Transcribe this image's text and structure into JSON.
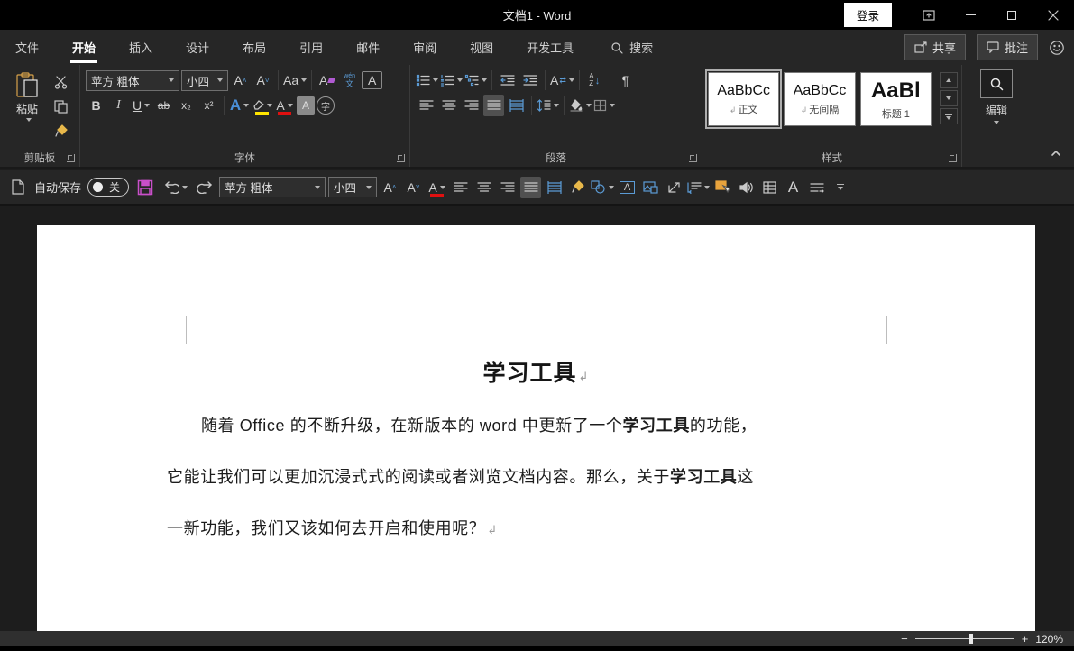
{
  "titlebar": {
    "title": "文档1 - Word",
    "signin_label": "登录"
  },
  "tab_row": {
    "tabs": [
      "文件",
      "开始",
      "插入",
      "设计",
      "布局",
      "引用",
      "邮件",
      "审阅",
      "视图",
      "开发工具"
    ],
    "active_tab": "开始",
    "search_label": "搜索",
    "share_label": "共享",
    "comments_label": "批注"
  },
  "ribbon": {
    "paste_label": "粘贴",
    "groups": {
      "clipboard": "剪贴板",
      "font": "字体",
      "paragraph": "段落",
      "styles": "样式"
    },
    "font_name": "苹方 粗体",
    "font_size": "小四",
    "glyphs": {
      "bold": "B",
      "italic": "I",
      "underline": "U",
      "strike": "ab",
      "sub": "x₂",
      "sup": "x²",
      "grow": "A",
      "shrink": "A",
      "case": "Aa",
      "clear": "A",
      "phon1": "wén",
      "phon2": "文",
      "border_a": "A",
      "effects": "A",
      "font_a": "A",
      "shade_a": "A",
      "enclose": "字",
      "sort_a": "A",
      "sort_z": "Z",
      "asian_a": "A",
      "big_a": "A",
      "pilcrow": "¶"
    },
    "style_mark": "↲",
    "styles_gallery": [
      {
        "sample": "AaBbCc",
        "name": "正文",
        "selected": true
      },
      {
        "sample": "AaBbCc",
        "name": "无间隔",
        "selected": false
      },
      {
        "sample": "AaBl",
        "name": "标题 1",
        "selected": false
      }
    ],
    "editing_label": "编辑"
  },
  "quickbar": {
    "autosave_label": "自动保存",
    "autosave_state": "关",
    "font_name": "苹方 粗体",
    "font_size": "小四"
  },
  "document": {
    "title": "学习工具",
    "pilcrow": "↲",
    "lines": [
      {
        "pre": "随着 Office 的不断升级，在新版本的 word 中更新了一个",
        "bold": "学习工具",
        "post": "的功能，"
      },
      {
        "pre": "它能让我们可以更加沉浸式式的阅读或者浏览文档内容。那么，关于",
        "bold": "学习工具",
        "post": "这"
      },
      {
        "pre": "一新功能，我们又该如何去开启和使用呢？",
        "bold": "",
        "post": ""
      }
    ]
  },
  "statusbar": {
    "zoom_level": "120%"
  },
  "colors": {
    "titlebar_bg": "#000000",
    "ribbon_bg": "#262626",
    "doc_bg": "#1d1d1d",
    "statusbar_bg": "#2f2f2f",
    "accent_blue": "#5b9bd5",
    "save_magenta": "#c94fc9",
    "highlight_yellow": "#ffe400",
    "font_red": "#e01010"
  }
}
